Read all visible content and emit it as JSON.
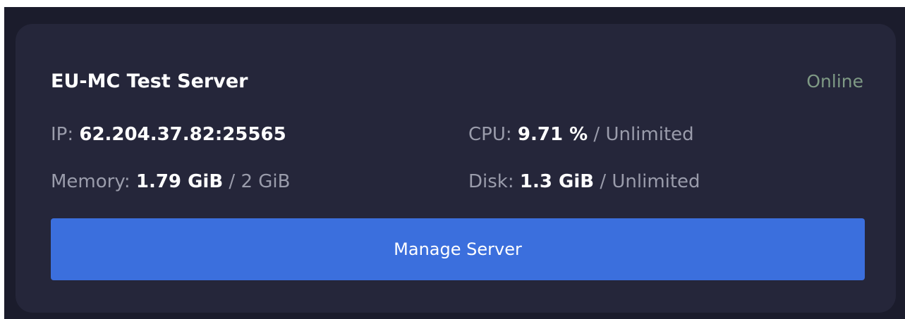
{
  "server": {
    "name": "EU-MC Test Server",
    "status": "Online",
    "ip": {
      "label": "IP: ",
      "value": "62.204.37.82:25565"
    },
    "cpu": {
      "label": "CPU: ",
      "value": "9.71 %",
      "separator": " / ",
      "limit": "Unlimited"
    },
    "memory": {
      "label": "Memory: ",
      "value": "1.79 GiB",
      "separator": " / ",
      "limit": "2 GiB"
    },
    "disk": {
      "label": "Disk: ",
      "value": "1.3 GiB",
      "separator": " / ",
      "limit": "Unlimited"
    },
    "manage_label": "Manage Server"
  },
  "colors": {
    "background": "#1b1c2c",
    "card": "#25263a",
    "status_online": "#7f9a85",
    "button": "#3b6fdd",
    "muted_text": "#9a9cab"
  }
}
